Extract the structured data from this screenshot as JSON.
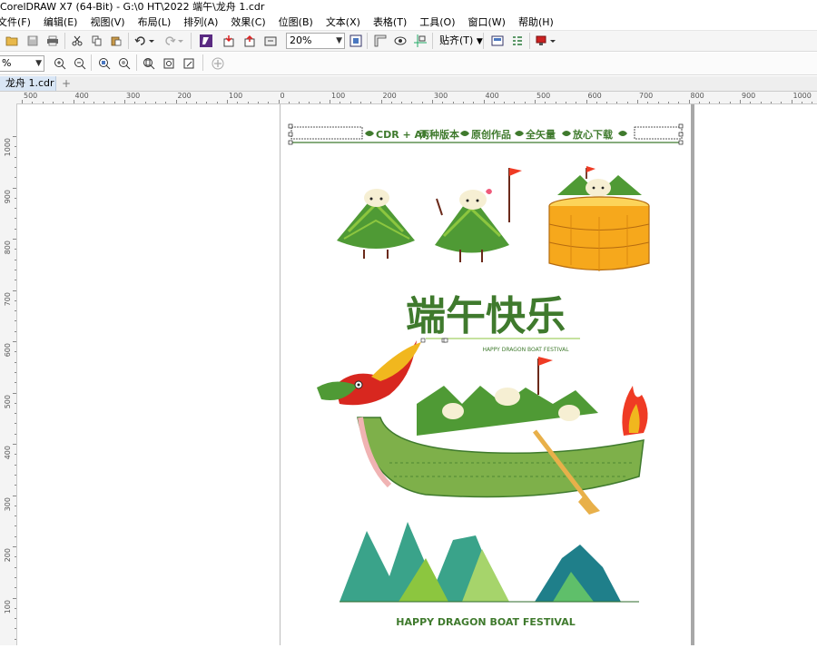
{
  "window": {
    "title": "CorelDRAW X7 (64-Bit) - G:\\0 HT\\2022 端午\\龙舟 1.cdr"
  },
  "menu": [
    {
      "id": "file",
      "label": "文件(F)"
    },
    {
      "id": "edit",
      "label": "编辑(E)"
    },
    {
      "id": "view",
      "label": "视图(V)"
    },
    {
      "id": "layout",
      "label": "布局(L)"
    },
    {
      "id": "arrange",
      "label": "排列(A)"
    },
    {
      "id": "effects",
      "label": "效果(C)"
    },
    {
      "id": "bitmaps",
      "label": "位图(B)"
    },
    {
      "id": "text",
      "label": "文本(X)"
    },
    {
      "id": "table",
      "label": "表格(T)"
    },
    {
      "id": "tools",
      "label": "工具(O)"
    },
    {
      "id": "window",
      "label": "窗口(W)"
    },
    {
      "id": "help",
      "label": "帮助(H)"
    }
  ],
  "toolbar": {
    "zoom_value": "20%",
    "snap_label": "贴齐(T)"
  },
  "toolbar2": {
    "zoom_combo": "%"
  },
  "tabs": {
    "document": "龙舟 1.cdr",
    "add": "+"
  },
  "ruler": {
    "h_labels": [
      "500",
      "400",
      "300",
      "200",
      "100",
      "0",
      "100",
      "200",
      "300",
      "400",
      "500",
      "600",
      "700",
      "800",
      "900",
      "1000"
    ],
    "v_labels": [
      "1000",
      "900",
      "800",
      "700",
      "600",
      "500",
      "400",
      "300",
      "200",
      "100"
    ]
  },
  "artwork": {
    "banner": {
      "item1": "CDR + AI",
      "item2": "两种版本",
      "item3": "原创作品",
      "item4": "全矢量",
      "item5": "放心下载"
    },
    "headline": "端午快乐",
    "headline_sub": "HAPPY DRAGON BOAT FESTIVAL",
    "footer": "HAPPY DRAGON BOAT FESTIVAL"
  },
  "colors": {
    "zongzi_green": "#4f9a35",
    "zongzi_light": "#8cc63f",
    "rice": "#f6efd3",
    "steamer": "#f6a81c",
    "dragon_red": "#d8271f",
    "dragon_gold": "#f1b71e",
    "boat_green": "#7eb04a",
    "flame": "#ef3b24",
    "text_green": "#3f7a2d"
  }
}
